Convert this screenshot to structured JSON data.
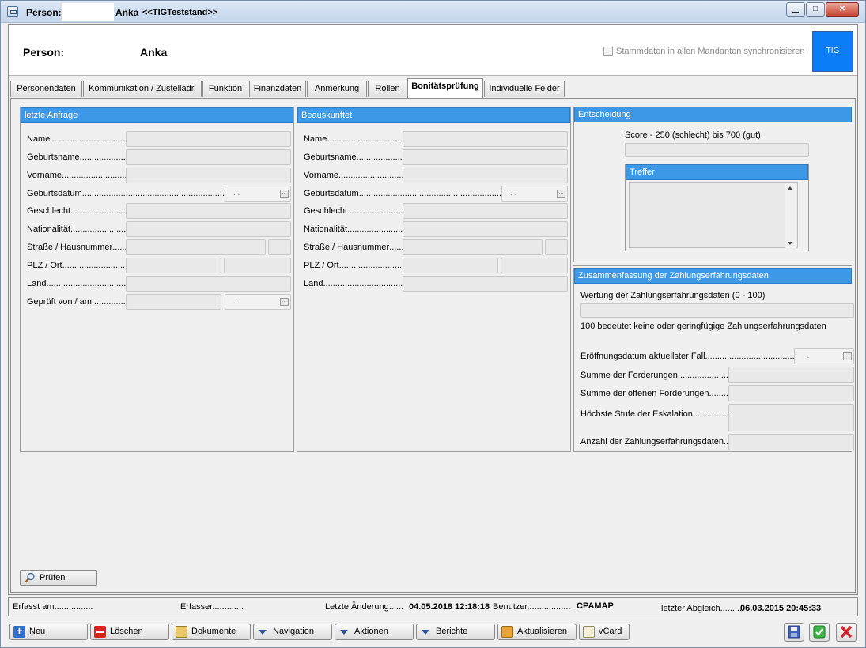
{
  "titlebar": {
    "label": "Person:",
    "name": "Anka",
    "context": "<<TIGTeststand>>",
    "minimize": "▁",
    "maximize": "□",
    "close": "✕"
  },
  "header": {
    "person_label": "Person:",
    "person_name": "Anka",
    "sync_label": "Stammdaten in allen Mandanten synchronisieren",
    "tig_button": "TIG"
  },
  "tabs": [
    {
      "label": "Personendaten"
    },
    {
      "label": "Kommunikation / Zustelladr."
    },
    {
      "label": "Funktion"
    },
    {
      "label": "Finanzdaten"
    },
    {
      "label": "Anmerkung"
    },
    {
      "label": "Rollen"
    },
    {
      "label": "Bonitätsprüfung",
      "active": true
    },
    {
      "label": "Individuelle Felder"
    }
  ],
  "letzte_anfrage": {
    "title": "letzte Anfrage",
    "fields": [
      "Name",
      "Geburtsname",
      "Vorname",
      "Geburtsdatum",
      "Geschlecht",
      "Nationalität",
      "Straße / Hausnummer",
      "PLZ / Ort",
      "Land",
      "Geprüft von / am"
    ],
    "date_placeholder": ". .",
    "date_placeholder_2": ". ."
  },
  "beauskunftet": {
    "title": "Beauskunftet",
    "fields": [
      "Name",
      "Geburtsname",
      "Vorname",
      "Geburtsdatum",
      "Geschlecht",
      "Nationalität",
      "Straße / Hausnummer",
      "PLZ / Ort",
      "Land"
    ],
    "date_placeholder": ". ."
  },
  "entscheidung": {
    "title": "Entscheidung",
    "score_label": "Score - 250 (schlecht) bis 700 (gut)",
    "treffer_title": "Treffer"
  },
  "zusammenfassung": {
    "title": "Zusammenfassung der Zahlungserfahrungsdaten",
    "wertung_label": "Wertung der Zahlungserfahrungsdaten (0 - 100)",
    "wertung_note": "100 bedeutet keine oder geringfügige Zahlungserfahrungsdaten",
    "fields": [
      "Eröffnungsdatum aktuellster Fall",
      "Summe der Forderungen",
      "Summe der offenen Forderungen",
      "Höchste Stufe der Eskalation",
      "Anzahl der Zahlungserfahrungsdaten"
    ],
    "date_placeholder": ". ."
  },
  "pruefen_button": "Prüfen",
  "status": {
    "erfasst_label": "Erfasst am",
    "erfasser_label": "Erfasser",
    "letzte_aenderung_label": "Letzte Änderung",
    "letzte_aenderung_value": "04.05.2018 12:18:18",
    "benutzer_label": "Benutzer",
    "benutzer_value": "CPAMAP",
    "letzter_abgleich_label": "letzter Abgleich",
    "letzter_abgleich_value": "06.03.2015 20:45:33"
  },
  "toolbar": {
    "neu": "Neu",
    "loeschen": "Löschen",
    "dokumente": "Dokumente",
    "navigation": "Navigation",
    "aktionen": "Aktionen",
    "berichte": "Berichte",
    "aktualisieren": "Aktualisieren",
    "vcard": "vCard"
  }
}
